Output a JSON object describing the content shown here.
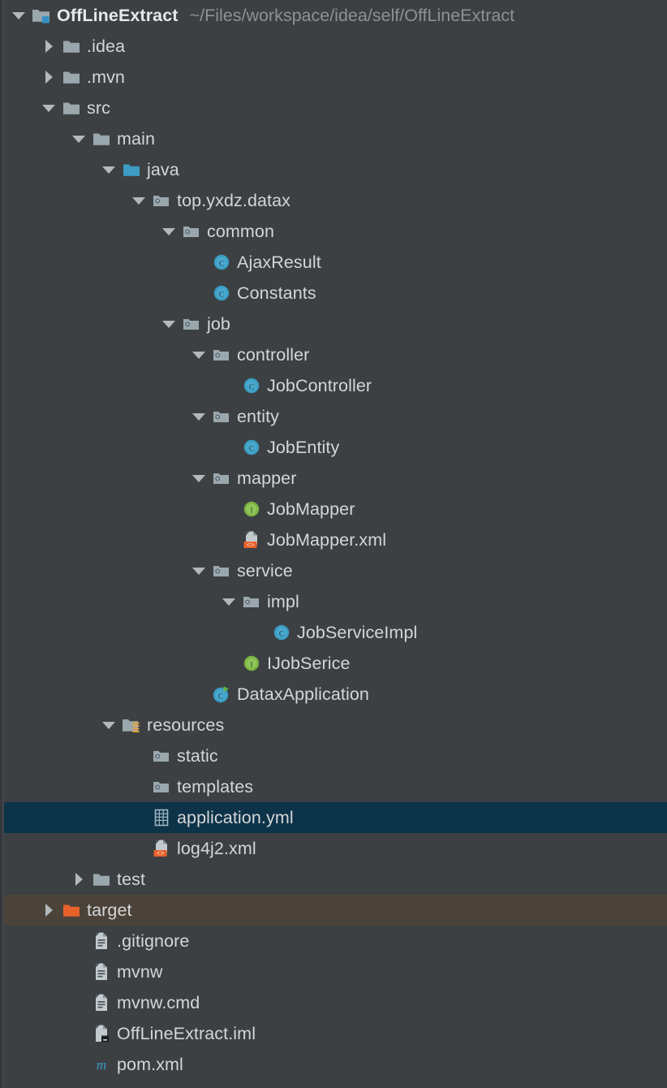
{
  "panel": {
    "name": "project-tool-window",
    "background": "#3c4043",
    "selection_color": "#0d3349",
    "hover_color": "#4b4339",
    "text_color": "#d4d6d7",
    "path_color": "#8b9296"
  },
  "root": {
    "label": "OffLineExtract",
    "path": "~/Files/workspace/idea/self/OffLineExtract",
    "icon": "module-folder-icon",
    "state": "expanded"
  },
  "rows": [
    {
      "label": "OffLineExtract",
      "path": "~/Files/workspace/idea/self/OffLineExtract",
      "depth": 0,
      "twisty": "expanded",
      "icon": "module-folder-icon",
      "bold": true,
      "state": "normal"
    },
    {
      "label": ".idea",
      "path": "",
      "depth": 1,
      "twisty": "collapsed",
      "icon": "folder-icon",
      "bold": false,
      "state": "normal"
    },
    {
      "label": ".mvn",
      "path": "",
      "depth": 1,
      "twisty": "collapsed",
      "icon": "folder-icon",
      "bold": false,
      "state": "normal"
    },
    {
      "label": "src",
      "path": "",
      "depth": 1,
      "twisty": "expanded",
      "icon": "folder-icon",
      "bold": false,
      "state": "normal"
    },
    {
      "label": "main",
      "path": "",
      "depth": 2,
      "twisty": "expanded",
      "icon": "folder-icon",
      "bold": false,
      "state": "normal"
    },
    {
      "label": "java",
      "path": "",
      "depth": 3,
      "twisty": "expanded",
      "icon": "source-root-icon",
      "bold": false,
      "state": "normal"
    },
    {
      "label": "top.yxdz.datax",
      "path": "",
      "depth": 4,
      "twisty": "expanded",
      "icon": "package-icon",
      "bold": false,
      "state": "normal"
    },
    {
      "label": "common",
      "path": "",
      "depth": 5,
      "twisty": "expanded",
      "icon": "package-icon",
      "bold": false,
      "state": "normal"
    },
    {
      "label": "AjaxResult",
      "path": "",
      "depth": 6,
      "twisty": "none",
      "icon": "java-class-icon",
      "bold": false,
      "state": "normal"
    },
    {
      "label": "Constants",
      "path": "",
      "depth": 6,
      "twisty": "none",
      "icon": "java-class-icon",
      "bold": false,
      "state": "normal"
    },
    {
      "label": "job",
      "path": "",
      "depth": 5,
      "twisty": "expanded",
      "icon": "package-icon",
      "bold": false,
      "state": "normal"
    },
    {
      "label": "controller",
      "path": "",
      "depth": 6,
      "twisty": "expanded",
      "icon": "package-icon",
      "bold": false,
      "state": "normal"
    },
    {
      "label": "JobController",
      "path": "",
      "depth": 7,
      "twisty": "none",
      "icon": "java-class-icon",
      "bold": false,
      "state": "normal"
    },
    {
      "label": "entity",
      "path": "",
      "depth": 6,
      "twisty": "expanded",
      "icon": "package-icon",
      "bold": false,
      "state": "normal"
    },
    {
      "label": "JobEntity",
      "path": "",
      "depth": 7,
      "twisty": "none",
      "icon": "java-class-icon",
      "bold": false,
      "state": "normal"
    },
    {
      "label": "mapper",
      "path": "",
      "depth": 6,
      "twisty": "expanded",
      "icon": "package-icon",
      "bold": false,
      "state": "normal"
    },
    {
      "label": "JobMapper",
      "path": "",
      "depth": 7,
      "twisty": "none",
      "icon": "java-interface-icon",
      "bold": false,
      "state": "normal"
    },
    {
      "label": "JobMapper.xml",
      "path": "",
      "depth": 7,
      "twisty": "none",
      "icon": "xml-file-icon",
      "bold": false,
      "state": "normal"
    },
    {
      "label": "service",
      "path": "",
      "depth": 6,
      "twisty": "expanded",
      "icon": "package-icon",
      "bold": false,
      "state": "normal"
    },
    {
      "label": "impl",
      "path": "",
      "depth": 7,
      "twisty": "expanded",
      "icon": "package-icon",
      "bold": false,
      "state": "normal"
    },
    {
      "label": "JobServiceImpl",
      "path": "",
      "depth": 8,
      "twisty": "none",
      "icon": "java-class-icon",
      "bold": false,
      "state": "normal"
    },
    {
      "label": "IJobSerice",
      "path": "",
      "depth": 7,
      "twisty": "none",
      "icon": "java-interface-icon",
      "bold": false,
      "state": "normal"
    },
    {
      "label": "DataxApplication",
      "path": "",
      "depth": 6,
      "twisty": "none",
      "icon": "runnable-class-icon",
      "bold": false,
      "state": "normal"
    },
    {
      "label": "resources",
      "path": "",
      "depth": 3,
      "twisty": "expanded",
      "icon": "resource-root-icon",
      "bold": false,
      "state": "normal"
    },
    {
      "label": "static",
      "path": "",
      "depth": 4,
      "twisty": "none",
      "icon": "package-icon",
      "bold": false,
      "state": "normal"
    },
    {
      "label": "templates",
      "path": "",
      "depth": 4,
      "twisty": "none",
      "icon": "package-icon",
      "bold": false,
      "state": "normal"
    },
    {
      "label": "application.yml",
      "path": "",
      "depth": 4,
      "twisty": "none",
      "icon": "yml-file-icon",
      "bold": false,
      "state": "selected"
    },
    {
      "label": "log4j2.xml",
      "path": "",
      "depth": 4,
      "twisty": "none",
      "icon": "xml-file-icon",
      "bold": false,
      "state": "normal"
    },
    {
      "label": "test",
      "path": "",
      "depth": 2,
      "twisty": "collapsed",
      "icon": "folder-icon",
      "bold": false,
      "state": "normal"
    },
    {
      "label": "target",
      "path": "",
      "depth": 1,
      "twisty": "collapsed",
      "icon": "excluded-folder-icon",
      "bold": false,
      "state": "hovered"
    },
    {
      "label": ".gitignore",
      "path": "",
      "depth": 2,
      "twisty": "none",
      "icon": "text-file-icon",
      "bold": false,
      "state": "normal"
    },
    {
      "label": "mvnw",
      "path": "",
      "depth": 2,
      "twisty": "none",
      "icon": "text-file-icon",
      "bold": false,
      "state": "normal"
    },
    {
      "label": "mvnw.cmd",
      "path": "",
      "depth": 2,
      "twisty": "none",
      "icon": "text-file-icon",
      "bold": false,
      "state": "normal"
    },
    {
      "label": "OffLineExtract.iml",
      "path": "",
      "depth": 2,
      "twisty": "none",
      "icon": "iml-file-icon",
      "bold": false,
      "state": "normal"
    },
    {
      "label": "pom.xml",
      "path": "",
      "depth": 2,
      "twisty": "none",
      "icon": "maven-pom-icon",
      "bold": false,
      "state": "normal"
    }
  ]
}
